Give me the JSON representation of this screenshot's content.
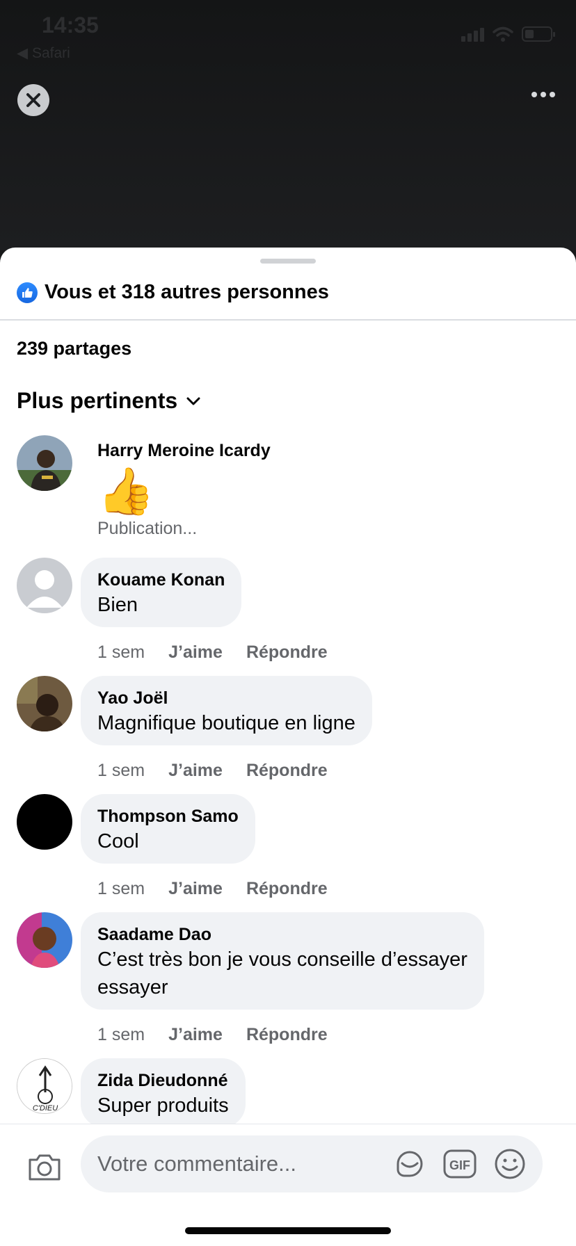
{
  "status_bar": {
    "time": "14:35",
    "back_label": "◀ Safari"
  },
  "reactions": {
    "summary": "Vous et 318 autres personnes"
  },
  "shares": {
    "count_text": "239 partages"
  },
  "sort": {
    "label": "Plus pertinents"
  },
  "comments": [
    {
      "author": "Harry Meroine Icardy",
      "text": "👍",
      "status": "Publication...",
      "avatar_color": "#6b7c8c"
    },
    {
      "author": "Kouame Konan",
      "text": "Bien",
      "time": "1 sem",
      "like": "J’aime",
      "reply": "Répondre",
      "avatar_color": "#c9ccd1"
    },
    {
      "author": "Yao Joël",
      "text": "Magnifique boutique en ligne",
      "time": "1 sem",
      "like": "J’aime",
      "reply": "Répondre",
      "avatar_color": "#5a4632"
    },
    {
      "author": "Thompson Samo",
      "text": "Cool",
      "time": "1 sem",
      "like": "J’aime",
      "reply": "Répondre",
      "avatar_color": "#000000"
    },
    {
      "author": "Saadame Dao",
      "text": "C’est très bon je vous conseille d’essayer",
      "text2": "essayer",
      "time": "1 sem",
      "like": "J’aime",
      "reply": "Répondre",
      "avatar_color": "#7a5fd0"
    },
    {
      "author": "Zida Dieudonné",
      "text": "Super produits",
      "avatar_label": "C'DIEU",
      "avatar_color": "#ffffff"
    }
  ],
  "composer": {
    "placeholder": "Votre commentaire...",
    "gif_label": "GIF"
  },
  "colors": {
    "accent": "#1877f2",
    "bubble": "#f0f2f5",
    "secondary_text": "#65676b"
  }
}
